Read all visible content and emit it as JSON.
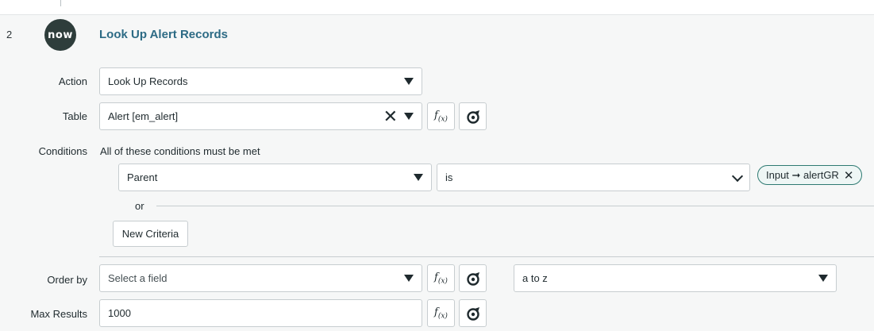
{
  "step": {
    "number": "2",
    "logo_text": "now",
    "title": "Look Up Alert Records"
  },
  "action": {
    "label": "Action",
    "value": "Look Up Records"
  },
  "table": {
    "label": "Table",
    "value": "Alert [em_alert]",
    "clear_icon": "✕"
  },
  "conditions": {
    "label": "Conditions",
    "heading": "All of these conditions must be met",
    "field": "Parent",
    "operator": "is",
    "value_pill": "Input ➞ alertGR",
    "pill_remove": "✕",
    "or_label": "or",
    "new_criteria": "New Criteria"
  },
  "order_by": {
    "label": "Order by",
    "placeholder": "Select a field",
    "direction": "a to z"
  },
  "max_results": {
    "label": "Max Results",
    "value": "1000"
  },
  "icons": {
    "function": "f(x)",
    "data_pill_picker": "data-pill-picker-icon"
  }
}
